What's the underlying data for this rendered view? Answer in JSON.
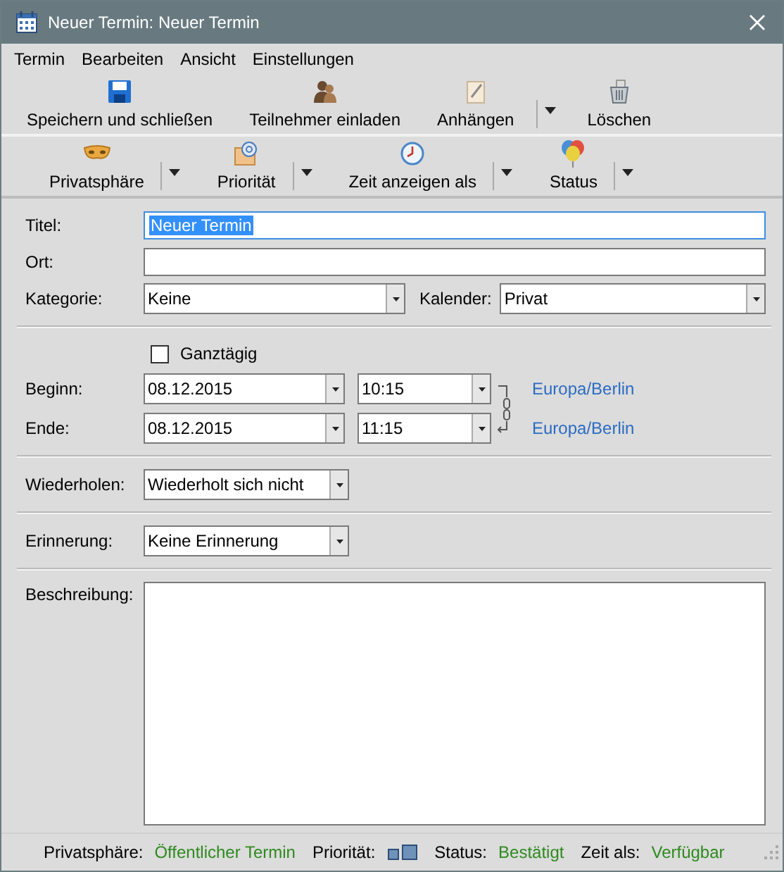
{
  "window": {
    "title": "Neuer Termin: Neuer Termin"
  },
  "menu": [
    "Termin",
    "Bearbeiten",
    "Ansicht",
    "Einstellungen"
  ],
  "toolbar": [
    {
      "label": "Speichern und schließen",
      "dropdown": false
    },
    {
      "label": "Teilnehmer einladen",
      "dropdown": false
    },
    {
      "label": "Anhängen",
      "dropdown": true
    },
    {
      "label": "Löschen",
      "dropdown": false
    }
  ],
  "toolbar2": [
    {
      "label": "Privatsphäre",
      "dropdown": true
    },
    {
      "label": "Priorität",
      "dropdown": true
    },
    {
      "label": "Zeit anzeigen als",
      "dropdown": true
    },
    {
      "label": "Status",
      "dropdown": true
    }
  ],
  "form": {
    "title": {
      "label": "Titel:",
      "value": "Neuer Termin",
      "focused": true
    },
    "location": {
      "label": "Ort:"
    },
    "category": {
      "label": "Kategorie:",
      "value": "Keine"
    },
    "calendar": {
      "label": "Kalender:",
      "value": "Privat"
    },
    "all_day": {
      "label": "Ganztägig",
      "checked": false
    },
    "start": {
      "label": "Beginn:",
      "date": "08.12.2015",
      "time": "10:15",
      "timezone": "Europa/Berlin"
    },
    "end": {
      "label": "Ende:",
      "date": "08.12.2015",
      "time": "11:15",
      "timezone": "Europa/Berlin"
    },
    "repeat": {
      "label": "Wiederholen:",
      "value": "Wiederholt sich nicht"
    },
    "reminder": {
      "label": "Erinnerung:",
      "value": "Keine Erinnerung"
    },
    "description": {
      "label": "Beschreibung:"
    }
  },
  "status_bar": {
    "privacy_label": "Privatsphäre:",
    "privacy": "Öffentlicher Termin",
    "priority_label": "Priorität:",
    "status_label": "Status:",
    "status": "Bestätigt",
    "show_as_label": "Zeit als:",
    "show_as": "Verfügbar"
  }
}
